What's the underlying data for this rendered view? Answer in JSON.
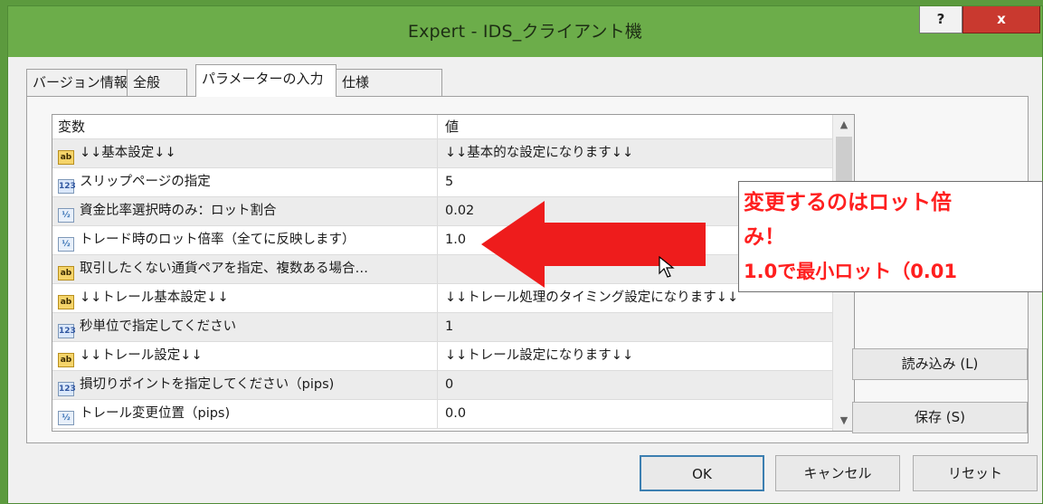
{
  "window": {
    "title": "Expert - IDS_クライアント機",
    "help_label": "?",
    "close_label": "x"
  },
  "tabs": [
    {
      "label": "バージョン情報"
    },
    {
      "label": "全般"
    },
    {
      "label": "パラメーターの入力"
    },
    {
      "label": "仕様"
    }
  ],
  "grid": {
    "header_name": "変数",
    "header_value": "値",
    "rows": [
      {
        "icon": "ab",
        "name": "↓↓基本設定↓↓",
        "value": "↓↓基本的な設定になります↓↓"
      },
      {
        "icon": "123",
        "name": "スリップページの指定",
        "value": "5"
      },
      {
        "icon": "½",
        "name": "資金比率選択時のみ：ロット割合",
        "value": "0.02"
      },
      {
        "icon": "½",
        "name": "トレード時のロット倍率（全てに反映します）",
        "value": "1.0"
      },
      {
        "icon": "ab",
        "name": "取引したくない通貨ペアを指定、複数ある場合…",
        "value": ""
      },
      {
        "icon": "ab",
        "name": "↓↓トレール基本設定↓↓",
        "value": "↓↓トレール処理のタイミング設定になります↓↓"
      },
      {
        "icon": "123",
        "name": "秒単位で指定してください",
        "value": "1"
      },
      {
        "icon": "ab",
        "name": "↓↓トレール設定↓↓",
        "value": "↓↓トレール設定になります↓↓"
      },
      {
        "icon": "123",
        "name": "損切りポイントを指定してください（pips)",
        "value": "0"
      },
      {
        "icon": "½",
        "name": "トレール変更位置（pips)",
        "value": "0.0"
      }
    ]
  },
  "buttons": {
    "load": "読み込み (L)",
    "save": "保存 (S)",
    "ok": "OK",
    "cancel": "キャンセル",
    "reset": "リセット"
  },
  "annotation": {
    "line1": "変更するのはロット倍",
    "line2": "み！",
    "line3": "1.0で最小ロット（0.01",
    "color": "#ff1f1f"
  },
  "arrow_color": "#ee1c1c"
}
